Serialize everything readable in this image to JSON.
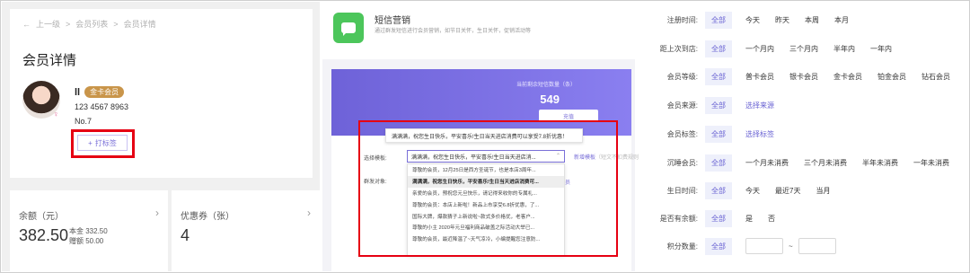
{
  "panel1": {
    "breadcrumb": {
      "back": "上一级",
      "list": "会员列表",
      "sep": ">",
      "current": "会员详情"
    },
    "title": "会员详情",
    "member": {
      "name": "ll",
      "vip_badge": "金卡会员",
      "gender_symbol": "♀",
      "phone": "123 4567 8963",
      "number": "No.7",
      "tag_button": "打标签"
    },
    "cards": [
      {
        "label": "余额（元）",
        "value": "382.50",
        "sub1": "本金 332.50",
        "sub2": "赠额 50.00"
      },
      {
        "label": "优惠券（张）",
        "value": "4"
      }
    ]
  },
  "panel2": {
    "header": {
      "title": "短信营销",
      "desc": "通过群发短信进行会员营销，如节日关怀，生日关怀，促销活动等"
    },
    "banner": {
      "label": "当前剩余短信数量（条）",
      "count": "549",
      "recharge": "充值"
    },
    "preview": "满满满，祝您生日快乐，平安喜乐!生日当天进店消费可以享受7.8折优惠！",
    "template_label": "选择模板:",
    "send_label": "群发对象:",
    "selected_template": "满满满，祝您生日快乐，平安喜乐!生日当天进店消...",
    "new_template": "新增模板",
    "new_template_hint": "（短文不扣费规则",
    "member_link": "员",
    "templates": [
      "尊敬的会员，12月25日是西方圣诞节，也是本店3周年...",
      "满满满，祝您生日快乐，平安喜乐!生日当天进店消费可...",
      "亲爱的会员，预祝您元旦快乐，请记得来收你的专属礼...",
      "尊敬的会员：本店上新啦！新品上市享受6.8折优惠，了...",
      "国际大牌，爆款猜子上新说啦~款式多价格优，老客户...",
      "尊敬的小主 2020年元旦福利商品破盖之际活动大举已...",
      "尊敬的会员，最近降温了~天气凉冷，小编提醒您注意防..."
    ]
  },
  "panel3": {
    "all_label": "全部",
    "rows": [
      {
        "label": "注册时间:",
        "options": [
          "今天",
          "昨天",
          "本周",
          "本月"
        ]
      },
      {
        "label": "距上次到店:",
        "options": [
          "一个月内",
          "三个月内",
          "半年内",
          "一年内"
        ]
      },
      {
        "label": "会员等级:",
        "options": [
          "普卡会员",
          "银卡会员",
          "金卡会员",
          "铂金会员",
          "钻石会员"
        ]
      },
      {
        "label": "会员来源:",
        "link": "选择来源"
      },
      {
        "label": "会员标签:",
        "link": "选择标签"
      },
      {
        "label": "沉睡会员:",
        "options": [
          "一个月未消费",
          "三个月未消费",
          "半年未消费",
          "一年未消费"
        ]
      },
      {
        "label": "生日时间:",
        "options": [
          "今天",
          "最近7天",
          "当月"
        ]
      },
      {
        "label": "是否有余额:",
        "options": [
          "是",
          "否"
        ]
      },
      {
        "label": "积分数量:",
        "range_sep": "~"
      }
    ]
  },
  "colors": {
    "accent": "#6a63d3",
    "highlight_box": "#e60012",
    "sms_green": "#4cc65b",
    "vip_gold": "#c9954a"
  }
}
